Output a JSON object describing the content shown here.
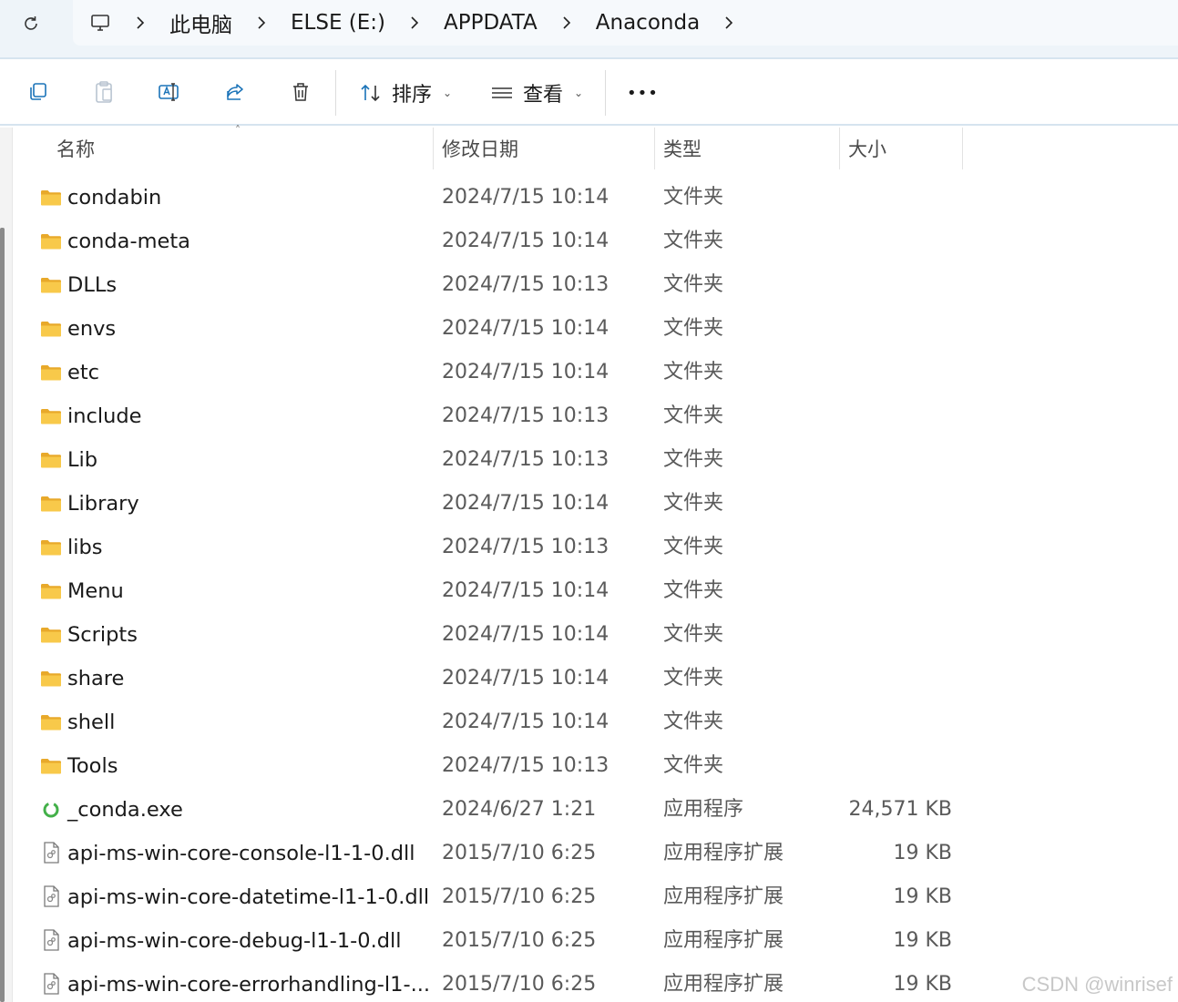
{
  "address_bar": {
    "crumbs": [
      "此电脑",
      "ELSE (E:)",
      "APPDATA",
      "Anaconda"
    ]
  },
  "commands": {
    "sort_label": "排序",
    "view_label": "查看",
    "more_label": "•••"
  },
  "columns": {
    "name": "名称",
    "modified": "修改日期",
    "type": "类型",
    "size": "大小"
  },
  "files": [
    {
      "name": "condabin",
      "modified": "2024/7/15 10:14",
      "type": "文件夹",
      "size": "",
      "icon": "folder-icon"
    },
    {
      "name": "conda-meta",
      "modified": "2024/7/15 10:14",
      "type": "文件夹",
      "size": "",
      "icon": "folder-icon"
    },
    {
      "name": "DLLs",
      "modified": "2024/7/15 10:13",
      "type": "文件夹",
      "size": "",
      "icon": "folder-icon"
    },
    {
      "name": "envs",
      "modified": "2024/7/15 10:14",
      "type": "文件夹",
      "size": "",
      "icon": "folder-icon"
    },
    {
      "name": "etc",
      "modified": "2024/7/15 10:14",
      "type": "文件夹",
      "size": "",
      "icon": "folder-icon"
    },
    {
      "name": "include",
      "modified": "2024/7/15 10:13",
      "type": "文件夹",
      "size": "",
      "icon": "folder-icon"
    },
    {
      "name": "Lib",
      "modified": "2024/7/15 10:13",
      "type": "文件夹",
      "size": "",
      "icon": "folder-icon"
    },
    {
      "name": "Library",
      "modified": "2024/7/15 10:14",
      "type": "文件夹",
      "size": "",
      "icon": "folder-icon"
    },
    {
      "name": "libs",
      "modified": "2024/7/15 10:13",
      "type": "文件夹",
      "size": "",
      "icon": "folder-icon"
    },
    {
      "name": "Menu",
      "modified": "2024/7/15 10:14",
      "type": "文件夹",
      "size": "",
      "icon": "folder-icon"
    },
    {
      "name": "Scripts",
      "modified": "2024/7/15 10:14",
      "type": "文件夹",
      "size": "",
      "icon": "folder-icon"
    },
    {
      "name": "share",
      "modified": "2024/7/15 10:14",
      "type": "文件夹",
      "size": "",
      "icon": "folder-icon"
    },
    {
      "name": "shell",
      "modified": "2024/7/15 10:14",
      "type": "文件夹",
      "size": "",
      "icon": "folder-icon"
    },
    {
      "name": "Tools",
      "modified": "2024/7/15 10:13",
      "type": "文件夹",
      "size": "",
      "icon": "folder-icon"
    },
    {
      "name": "_conda.exe",
      "modified": "2024/6/27 1:21",
      "type": "应用程序",
      "size": "24,571 KB",
      "icon": "exe-icon"
    },
    {
      "name": "api-ms-win-core-console-l1-1-0.dll",
      "modified": "2015/7/10 6:25",
      "type": "应用程序扩展",
      "size": "19 KB",
      "icon": "dll-icon"
    },
    {
      "name": "api-ms-win-core-datetime-l1-1-0.dll",
      "modified": "2015/7/10 6:25",
      "type": "应用程序扩展",
      "size": "19 KB",
      "icon": "dll-icon"
    },
    {
      "name": "api-ms-win-core-debug-l1-1-0.dll",
      "modified": "2015/7/10 6:25",
      "type": "应用程序扩展",
      "size": "19 KB",
      "icon": "dll-icon"
    },
    {
      "name": "api-ms-win-core-errorhandling-l1-...",
      "modified": "2015/7/10 6:25",
      "type": "应用程序扩展",
      "size": "19 KB",
      "icon": "dll-icon"
    }
  ],
  "watermark": "CSDN @winrisef",
  "colors": {
    "folder": "#f5c542",
    "accent": "#1a73b8",
    "address_bg": "#eef4f9"
  }
}
